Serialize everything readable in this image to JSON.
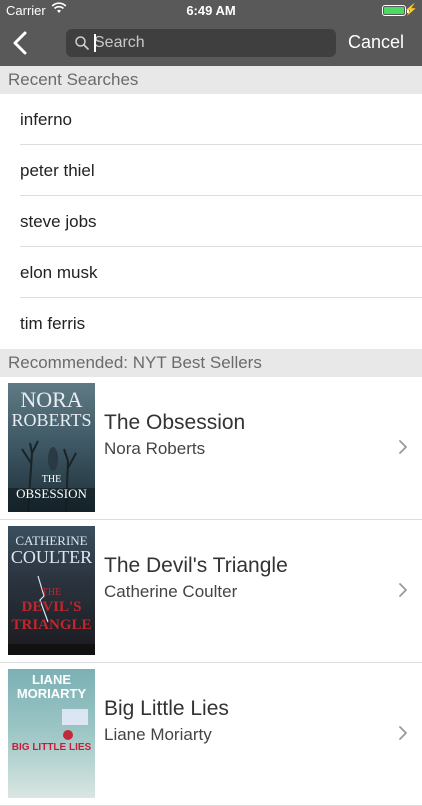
{
  "status_bar": {
    "carrier": "Carrier",
    "time": "6:49 AM"
  },
  "search": {
    "placeholder": "Search",
    "value": "",
    "cancel_label": "Cancel"
  },
  "recent": {
    "header": "Recent Searches",
    "items": [
      "inferno",
      "peter thiel",
      "steve jobs",
      "elon musk",
      "tim ferris"
    ]
  },
  "recommended": {
    "header": "Recommended: NYT Best Sellers",
    "books": [
      {
        "title": "The Obsession",
        "author": "Nora Roberts",
        "cover_author_line1": "NORA",
        "cover_author_line2": "ROBERTS",
        "cover_title_line1": "THE",
        "cover_title_line2": "OBSESSION"
      },
      {
        "title": "The Devil's Triangle",
        "author": "Catherine Coulter",
        "cover_author_line1": "CATHERINE",
        "cover_author_line2": "COULTER",
        "cover_title_line1": "THE",
        "cover_title_line2": "DEVIL'S",
        "cover_title_line3": "TRIANGLE"
      },
      {
        "title": "Big Little Lies",
        "author": "Liane Moriarty",
        "cover_author_line1": "LIANE",
        "cover_author_line2": "MORIARTY",
        "cover_title_line1": "BIG LITTLE LIES"
      }
    ]
  },
  "colors": {
    "nav_bar": "#595959",
    "search_field": "#3f3f3f",
    "section_header_bg": "#e8e8e8",
    "battery": "#4cd964"
  },
  "icons": {
    "back": "chevron-left-icon",
    "search": "magnifier-icon",
    "row_disclosure": "chevron-right-icon"
  }
}
